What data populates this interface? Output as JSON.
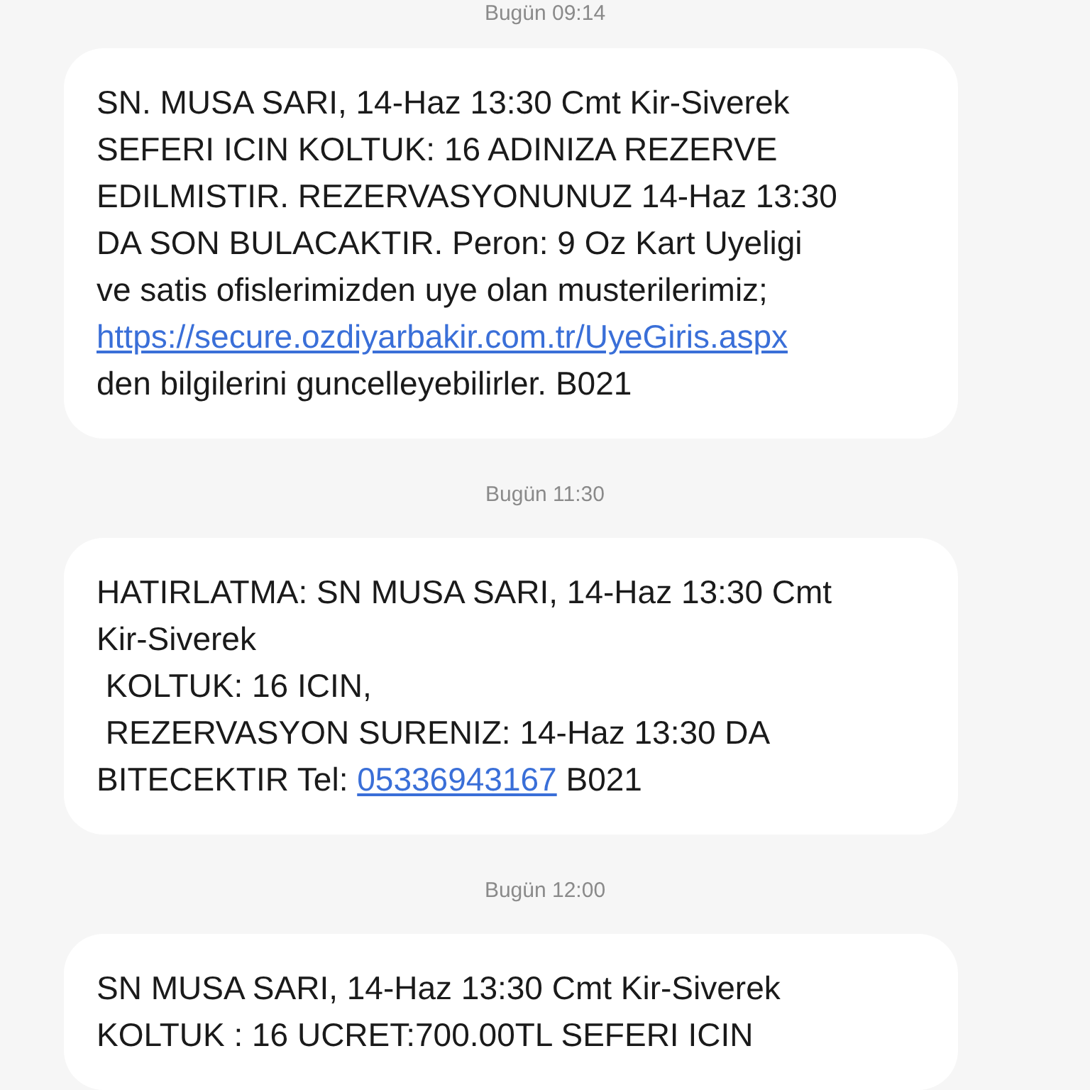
{
  "conversation": [
    {
      "timestamp": "Bugün 09:14",
      "parts": [
        {
          "kind": "text",
          "text": "SN. MUSA SARI, 14-Haz 13:30 Cmt Kir-Siverek\nSEFERI ICIN KOLTUK: 16 ADINIZA REZERVE\nEDILMISTIR. REZERVASYONUNUZ 14-Haz 13:30\nDA SON BULACAKTIR. Peron: 9 Oz Kart Uyeligi\nve satis ofislerimizden uye olan musterilerimiz;\n"
        },
        {
          "kind": "link",
          "text": "https://secure.ozdiyarbakir.com.tr/UyeGiris.aspx"
        },
        {
          "kind": "text",
          "text": "\nden bilgilerini guncelleyebilirler. B021"
        }
      ]
    },
    {
      "timestamp": "Bugün 11:30",
      "parts": [
        {
          "kind": "text",
          "text": "HATIRLATMA: SN MUSA SARI, 14-Haz 13:30 Cmt\nKir-Siverek\n KOLTUK: 16 ICIN,\n REZERVASYON SURENIZ: 14-Haz 13:30 DA\nBITECEKTIR Tel: "
        },
        {
          "kind": "link",
          "text": "05336943167"
        },
        {
          "kind": "text",
          "text": " B021"
        }
      ]
    },
    {
      "timestamp": "Bugün 12:00",
      "parts": [
        {
          "kind": "text",
          "text": "SN MUSA SARI, 14-Haz 13:30 Cmt Kir-Siverek\nKOLTUK : 16 UCRET:700.00TL SEFERI ICIN"
        }
      ]
    }
  ]
}
